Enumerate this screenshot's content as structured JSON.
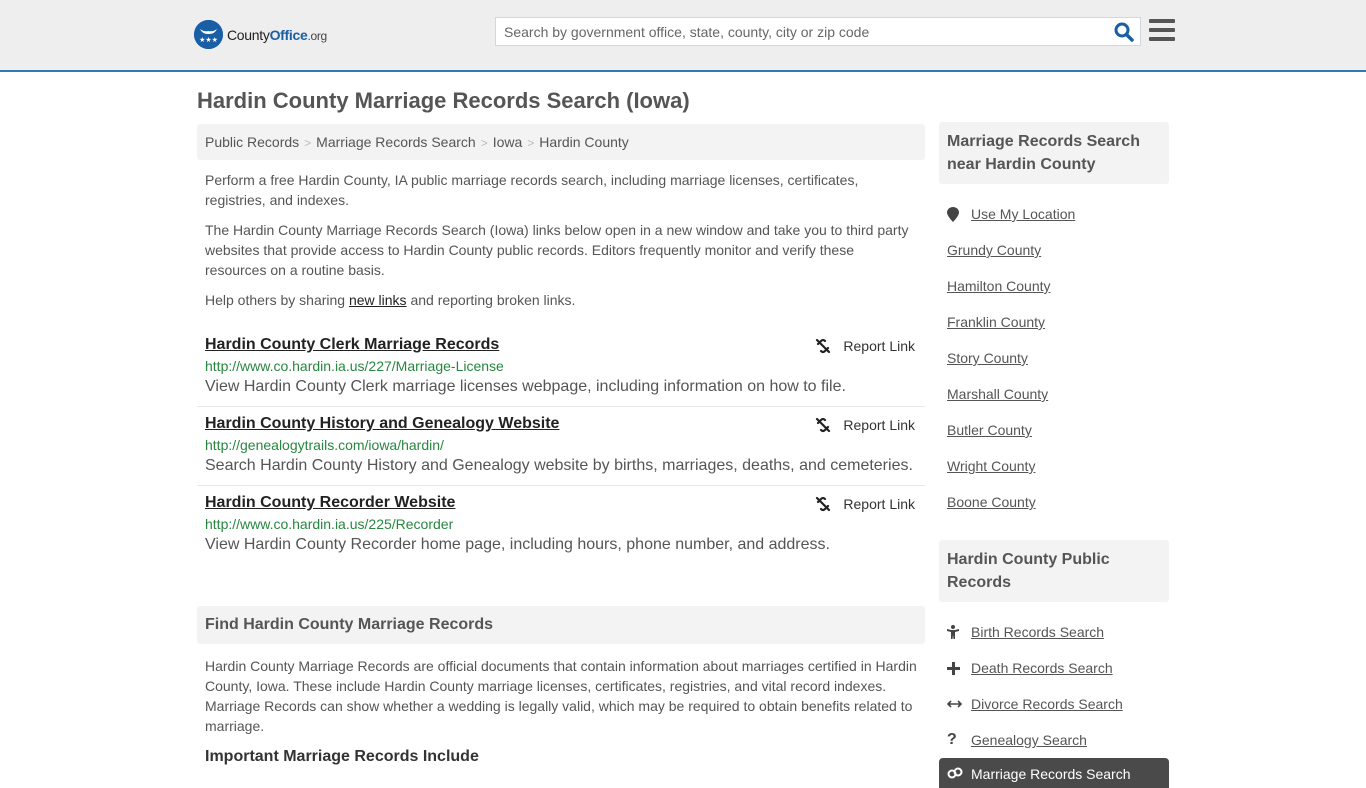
{
  "header": {
    "logo": {
      "text_county": "County",
      "text_office": "Office",
      "text_org": ".org",
      "icon": "eagle-stars-icon"
    },
    "search": {
      "placeholder": "Search by government office, state, county, city or zip code",
      "value": ""
    },
    "search_button_icon": "search-icon",
    "menu_icon": "hamburger-menu-icon"
  },
  "page": {
    "title": "Hardin County Marriage Records Search (Iowa)",
    "breadcrumbs": [
      "Public Records",
      "Marriage Records Search",
      "Iowa",
      "Hardin County"
    ],
    "intro": "Perform a free Hardin County, IA public marriage records search, including marriage licenses, certificates, registries, and indexes.",
    "disclaimer": "The Hardin County Marriage Records Search (Iowa) links below open in a new window and take you to third party websites that provide access to Hardin County public records. Editors frequently monitor and verify these resources on a routine basis.",
    "help": {
      "before": "Help others by sharing ",
      "link": "new links",
      "after": " and reporting broken links."
    }
  },
  "listings": [
    {
      "title": "Hardin County Clerk Marriage Records",
      "url": "http://www.co.hardin.ia.us/227/Marriage-License",
      "description": "View Hardin County Clerk marriage licenses webpage, including information on how to file.",
      "report_label": "Report Link"
    },
    {
      "title": "Hardin County History and Genealogy Website",
      "url": "http://genealogytrails.com/iowa/hardin/",
      "description": "Search Hardin County History and Genealogy website by births, marriages, deaths, and cemeteries.",
      "report_label": "Report Link"
    },
    {
      "title": "Hardin County Recorder Website",
      "url": "http://www.co.hardin.ia.us/225/Recorder",
      "description": "View Hardin County Recorder home page, including hours, phone number, and address.",
      "report_label": "Report Link"
    }
  ],
  "find_section": {
    "heading": "Find Hardin County Marriage Records",
    "body": "Hardin County Marriage Records are official documents that contain information about marriages certified in Hardin County, Iowa. These include Hardin County marriage licenses, certificates, registries, and vital record indexes. Marriage Records can show whether a wedding is legally valid, which may be required to obtain benefits related to marriage.",
    "subheading": "Important Marriage Records Include"
  },
  "sidebar": {
    "nearby": {
      "heading": "Marriage Records Search near Hardin County",
      "use_location": "Use My Location",
      "counties": [
        "Grundy County",
        "Hamilton County",
        "Franklin County",
        "Story County",
        "Marshall County",
        "Butler County",
        "Wright County",
        "Boone County"
      ]
    },
    "public_records": {
      "heading": "Hardin County Public Records",
      "items": [
        {
          "label": "Birth Records Search",
          "icon": "child-icon"
        },
        {
          "label": "Death Records Search",
          "icon": "plus-icon"
        },
        {
          "label": "Divorce Records Search",
          "icon": "arrows-horizontal-icon"
        },
        {
          "label": "Genealogy Search",
          "icon": "question-icon"
        }
      ],
      "active": {
        "label": "Marriage Records Search",
        "icon": "rings-icon"
      }
    }
  }
}
